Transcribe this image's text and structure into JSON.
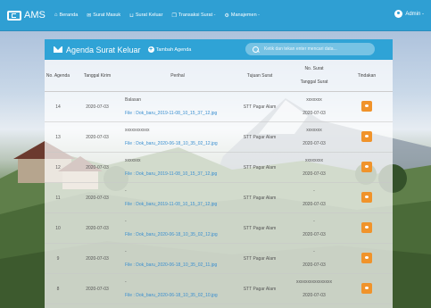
{
  "nav": {
    "brand": "AMS",
    "items": [
      {
        "label": "Beranda",
        "icon": "home-icon"
      },
      {
        "label": "Surat Masuk",
        "icon": "envelope-icon"
      },
      {
        "label": "Surat Keluar",
        "icon": "tray-icon"
      },
      {
        "label": "Transaksi Surat -",
        "icon": "copy-icon"
      },
      {
        "label": "Manajemen -",
        "icon": "gear-icon"
      }
    ],
    "user": "Admin -"
  },
  "card": {
    "title": "Agenda Surat Keluar",
    "add_label": "Tambah Agenda",
    "search_placeholder": "Ketik dan tekan enter mencari data..."
  },
  "table": {
    "headers": {
      "no": "No. Agenda",
      "tgl_kirim": "Tanggal Kirim",
      "perihal": "Perihal",
      "tujuan": "Tujuan Surat",
      "no_surat": "No. Surat",
      "tgl_surat": "Tanggal Surat",
      "tindakan": "Tindakan"
    },
    "rows": [
      {
        "no": "14",
        "tgl": "2020-07-03",
        "perihal": "Balasan",
        "file": "File : Dok_baru_2019-11-08_10_15_37_12.jpg",
        "tujuan": "STT Pagar Alam",
        "no_surat": "xxxxxxx",
        "tgl_surat": "2020-07-03"
      },
      {
        "no": "13",
        "tgl": "2020-07-03",
        "perihal": "xxxxxxxxxxx",
        "file": "File : Dok_baru_2020-06-18_10_35_02_12.jpg",
        "tujuan": "STT Pagar Alam",
        "no_surat": "xxxxxxx",
        "tgl_surat": "2020-07-03"
      },
      {
        "no": "12",
        "tgl": "2020-07-03",
        "perihal": "xxxxxxx",
        "file": "File : Dok_baru_2019-11-08_10_15_37_12.jpg",
        "tujuan": "STT Pagar Alam",
        "no_surat": "xxxxxxxx",
        "tgl_surat": "2020-07-03"
      },
      {
        "no": "11",
        "tgl": "2020-07-03",
        "perihal": "-",
        "file": "File : Dok_baru_2019-11-08_10_15_37_12.jpg",
        "tujuan": "STT Pagar Alam",
        "no_surat": "-",
        "tgl_surat": "2020-07-03"
      },
      {
        "no": "10",
        "tgl": "2020-07-03",
        "perihal": "-",
        "file": "File : Dok_baru_2020-06-18_10_35_02_12.jpg",
        "tujuan": "STT Pagar Alam",
        "no_surat": "-",
        "tgl_surat": "2020-07-03"
      },
      {
        "no": "9",
        "tgl": "2020-07-03",
        "perihal": "-",
        "file": "File : Dok_baru_2020-06-18_10_35_02_11.jpg",
        "tujuan": "STT Pagar Alam",
        "no_surat": "-",
        "tgl_surat": "2020-07-03"
      },
      {
        "no": "8",
        "tgl": "2020-07-03",
        "perihal": "-",
        "file": "File : Dok_baru_2020-06-18_10_35_02_10.jpg",
        "tujuan": "STT Pagar Alam",
        "no_surat": "xxxxxxxxxxxxxxxx",
        "tgl_surat": "2020-07-03"
      }
    ]
  },
  "colors": {
    "nav": "#2f9fd3",
    "action": "#f0932b",
    "link": "#3a8fd0"
  }
}
